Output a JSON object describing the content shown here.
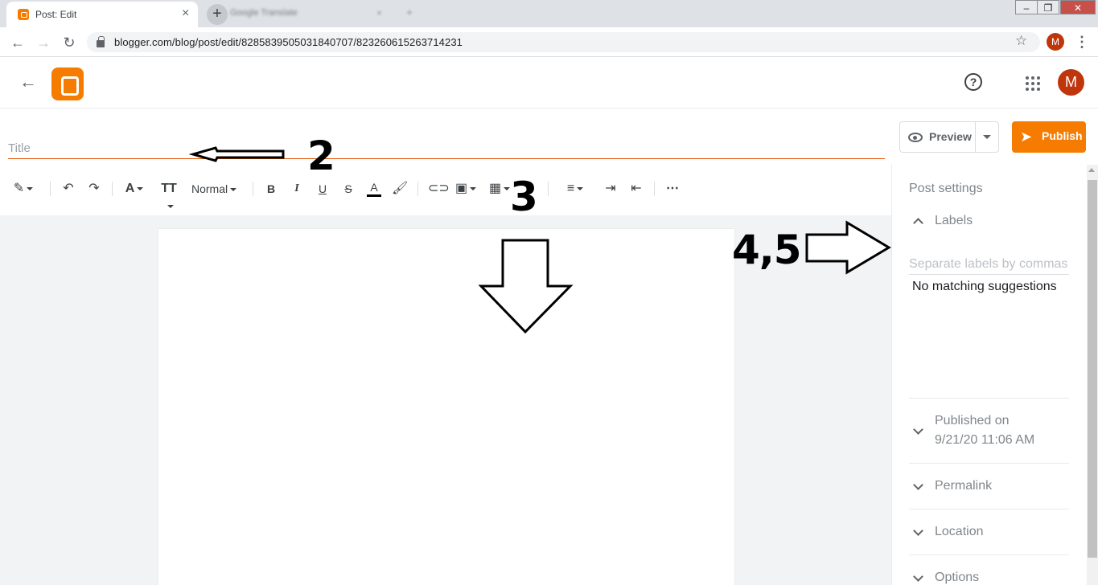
{
  "browser": {
    "active_tab_title": "Post: Edit",
    "background_tab_title": "Google Translate",
    "url": "blogger.com/blog/post/edit/8285839505031840707/823260615263714231",
    "profile_initial": "M"
  },
  "app": {
    "avatar_initial": "M",
    "help_symbol": "?",
    "logo_color": "#f57c00"
  },
  "editor": {
    "title_placeholder": "Title",
    "preview_label": "Preview",
    "publish_label": "Publish",
    "format_label": "Normal"
  },
  "sidebar": {
    "post_settings": "Post settings",
    "labels_title": "Labels",
    "labels_placeholder": "Separate labels by commas",
    "no_match": "No matching suggestions",
    "published_label": "Published on",
    "published_value": "9/21/20 11:06 AM",
    "permalink_label": "Permalink",
    "location_label": "Location",
    "options_label": "Options"
  },
  "annotations": {
    "arrow_2": "2",
    "arrow_3": "3",
    "arrow_45": "4,5"
  },
  "colors": {
    "accent": "#f57c00",
    "title_underline": "#e65100",
    "avatar": "#bf360c"
  },
  "icons": [
    "back-arrow-icon",
    "blogger-logo-icon",
    "help-icon",
    "apps-grid-icon",
    "eye-icon",
    "send-icon",
    "pen-icon",
    "undo-icon",
    "redo-icon",
    "text-style-icon",
    "font-size-icon",
    "bold-icon",
    "italic-icon",
    "underline-icon",
    "strikethrough-icon",
    "text-color-icon",
    "highlight-icon",
    "link-icon",
    "image-icon",
    "video-icon",
    "emoji-icon",
    "align-icon",
    "indent-icon",
    "outdent-icon",
    "more-icon"
  ]
}
